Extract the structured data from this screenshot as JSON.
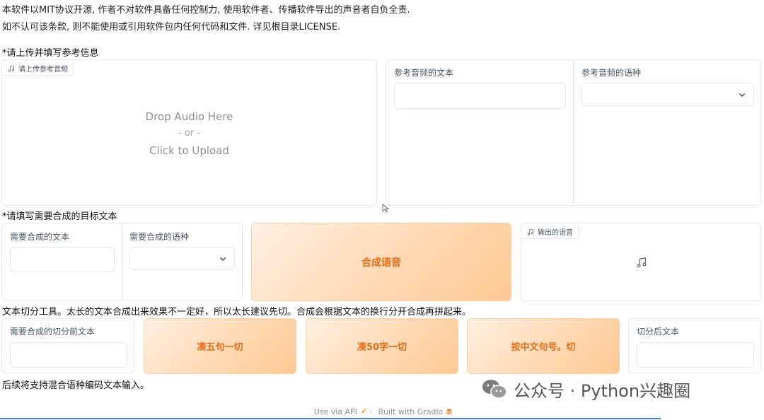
{
  "notice": {
    "line1": "本软件以MIT协议开源, 作者不对软件具备任何控制力, 使用软件者、传播软件导出的声音者自负全责.",
    "line2": "如不认可该条款, 则不能使用或引用软件包内任何代码和文件. 详见根目录LICENSE."
  },
  "reference": {
    "section_title": "*请上传并填写参考信息",
    "upload_tag": "请上传参考音频",
    "drop_text": "Drop Audio Here",
    "or_text": "- or -",
    "click_text": "Click to Upload",
    "ref_text_label": "参考音频的文本",
    "ref_text_value": "",
    "ref_lang_label": "参考音频的语种",
    "ref_lang_value": ""
  },
  "target": {
    "section_title": "*请填写需要合成的目标文本",
    "text_label": "需要合成的文本",
    "text_value": "",
    "lang_label": "需要合成的语种",
    "lang_value": "",
    "synth_button": "合成语音",
    "output_tag": "输出的语音"
  },
  "split": {
    "section_title": "文本切分工具。太长的文本合成出来效果不一定好，所以太长建议先切。合成会根据文本的换行分开合成再拼起来。",
    "input_label": "需要合成的切分前文本",
    "input_value": "",
    "btn_five": "凑五句一切",
    "btn_fifty": "凑50字一切",
    "btn_period": "按中文句号。切",
    "output_label": "切分后文本",
    "output_value": ""
  },
  "future_note": "后续将支持混合语种编码文本输入。",
  "footer": {
    "api": "Use via API",
    "separator": "·",
    "built": "Built with Gradio"
  },
  "watermark": {
    "text": "公众号 · Python兴趣圈"
  },
  "colors": {
    "accent": "#e86b12",
    "button_bg": "#ffd7b0",
    "border": "#e5e7eb"
  }
}
